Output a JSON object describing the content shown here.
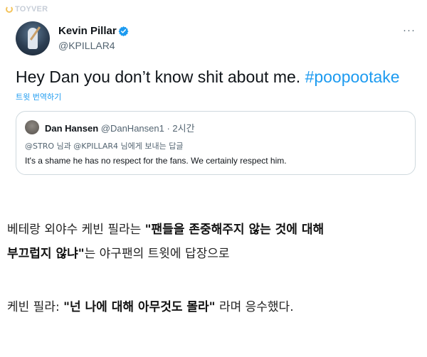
{
  "watermark": {
    "text": "TOYVER"
  },
  "tweet": {
    "author": {
      "name": "Kevin Pillar",
      "handle": "@KPILLAR4",
      "verified_color": "#1d9bf0"
    },
    "more_label": "···",
    "text": "Hey Dan you don’t know shit about me.",
    "hashtag": "#poopootake",
    "translate_label": "트윗 번역하기",
    "quote": {
      "name": "Dan Hansen",
      "handle": "@DanHansen1",
      "time": "· 2시간",
      "reply_context": "@STRO 님과 @KPILLAR4 님에게 보내는 답글",
      "text": "It's a shame he has no respect for the fans.  We certainly respect him."
    }
  },
  "article": {
    "line1_prefix": "베테랑 외야수 케빈 필라는 ",
    "line1_bold": "\"팬들을 존중해주지 않는 것에 대해",
    "line2_bold": "부끄럽지 않냐\"",
    "line2_suffix": "는 야구팬의 트윗에 답장으로",
    "line3_prefix": "케빈 필라: ",
    "line3_bold": "\"넌 나에 대해 아무것도 몰라\"",
    "line3_suffix": " 라며 응수했다."
  }
}
